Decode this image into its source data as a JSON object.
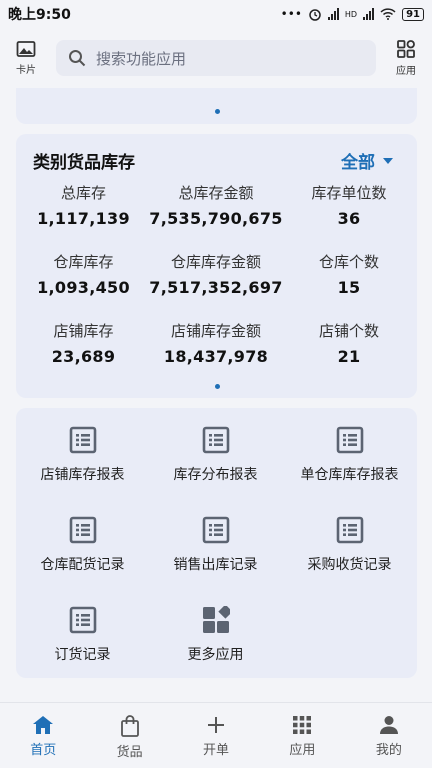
{
  "status_bar": {
    "time": "晚上9:50",
    "dots": "•••",
    "hd": "HD",
    "battery": "91"
  },
  "top_bar": {
    "left_label": "卡片",
    "search_placeholder": "搜索功能应用",
    "right_label": "应用"
  },
  "inventory": {
    "title": "类别货品库存",
    "filter": "全部",
    "metrics": [
      {
        "label": "总库存",
        "value": "1,117,139"
      },
      {
        "label": "总库存金额",
        "value": "7,535,790,675"
      },
      {
        "label": "库存单位数",
        "value": "36"
      },
      {
        "label": "仓库库存",
        "value": "1,093,450"
      },
      {
        "label": "仓库库存金额",
        "value": "7,517,352,697"
      },
      {
        "label": "仓库个数",
        "value": "15"
      },
      {
        "label": "店铺库存",
        "value": "23,689"
      },
      {
        "label": "店铺库存金额",
        "value": "18,437,978"
      },
      {
        "label": "店铺个数",
        "value": "21"
      }
    ]
  },
  "apps": [
    {
      "label": "店铺库存报表",
      "icon": "report-icon"
    },
    {
      "label": "库存分布报表",
      "icon": "report-icon"
    },
    {
      "label": "单仓库库存报表",
      "icon": "report-icon"
    },
    {
      "label": "仓库配货记录",
      "icon": "report-icon"
    },
    {
      "label": "销售出库记录",
      "icon": "report-icon"
    },
    {
      "label": "采购收货记录",
      "icon": "report-icon"
    },
    {
      "label": "订货记录",
      "icon": "report-icon"
    },
    {
      "label": "更多应用",
      "icon": "more-apps-icon"
    }
  ],
  "bottom_nav": [
    {
      "label": "首页",
      "icon": "home-icon",
      "active": true
    },
    {
      "label": "货品",
      "icon": "bag-icon",
      "active": false
    },
    {
      "label": "开单",
      "icon": "plus-icon",
      "active": false
    },
    {
      "label": "应用",
      "icon": "grid-icon",
      "active": false
    },
    {
      "label": "我的",
      "icon": "person-icon",
      "active": false
    }
  ],
  "colors": {
    "accent": "#1f6fb6",
    "card_bg": "#e9ecf7",
    "icon": "#5c6472"
  }
}
